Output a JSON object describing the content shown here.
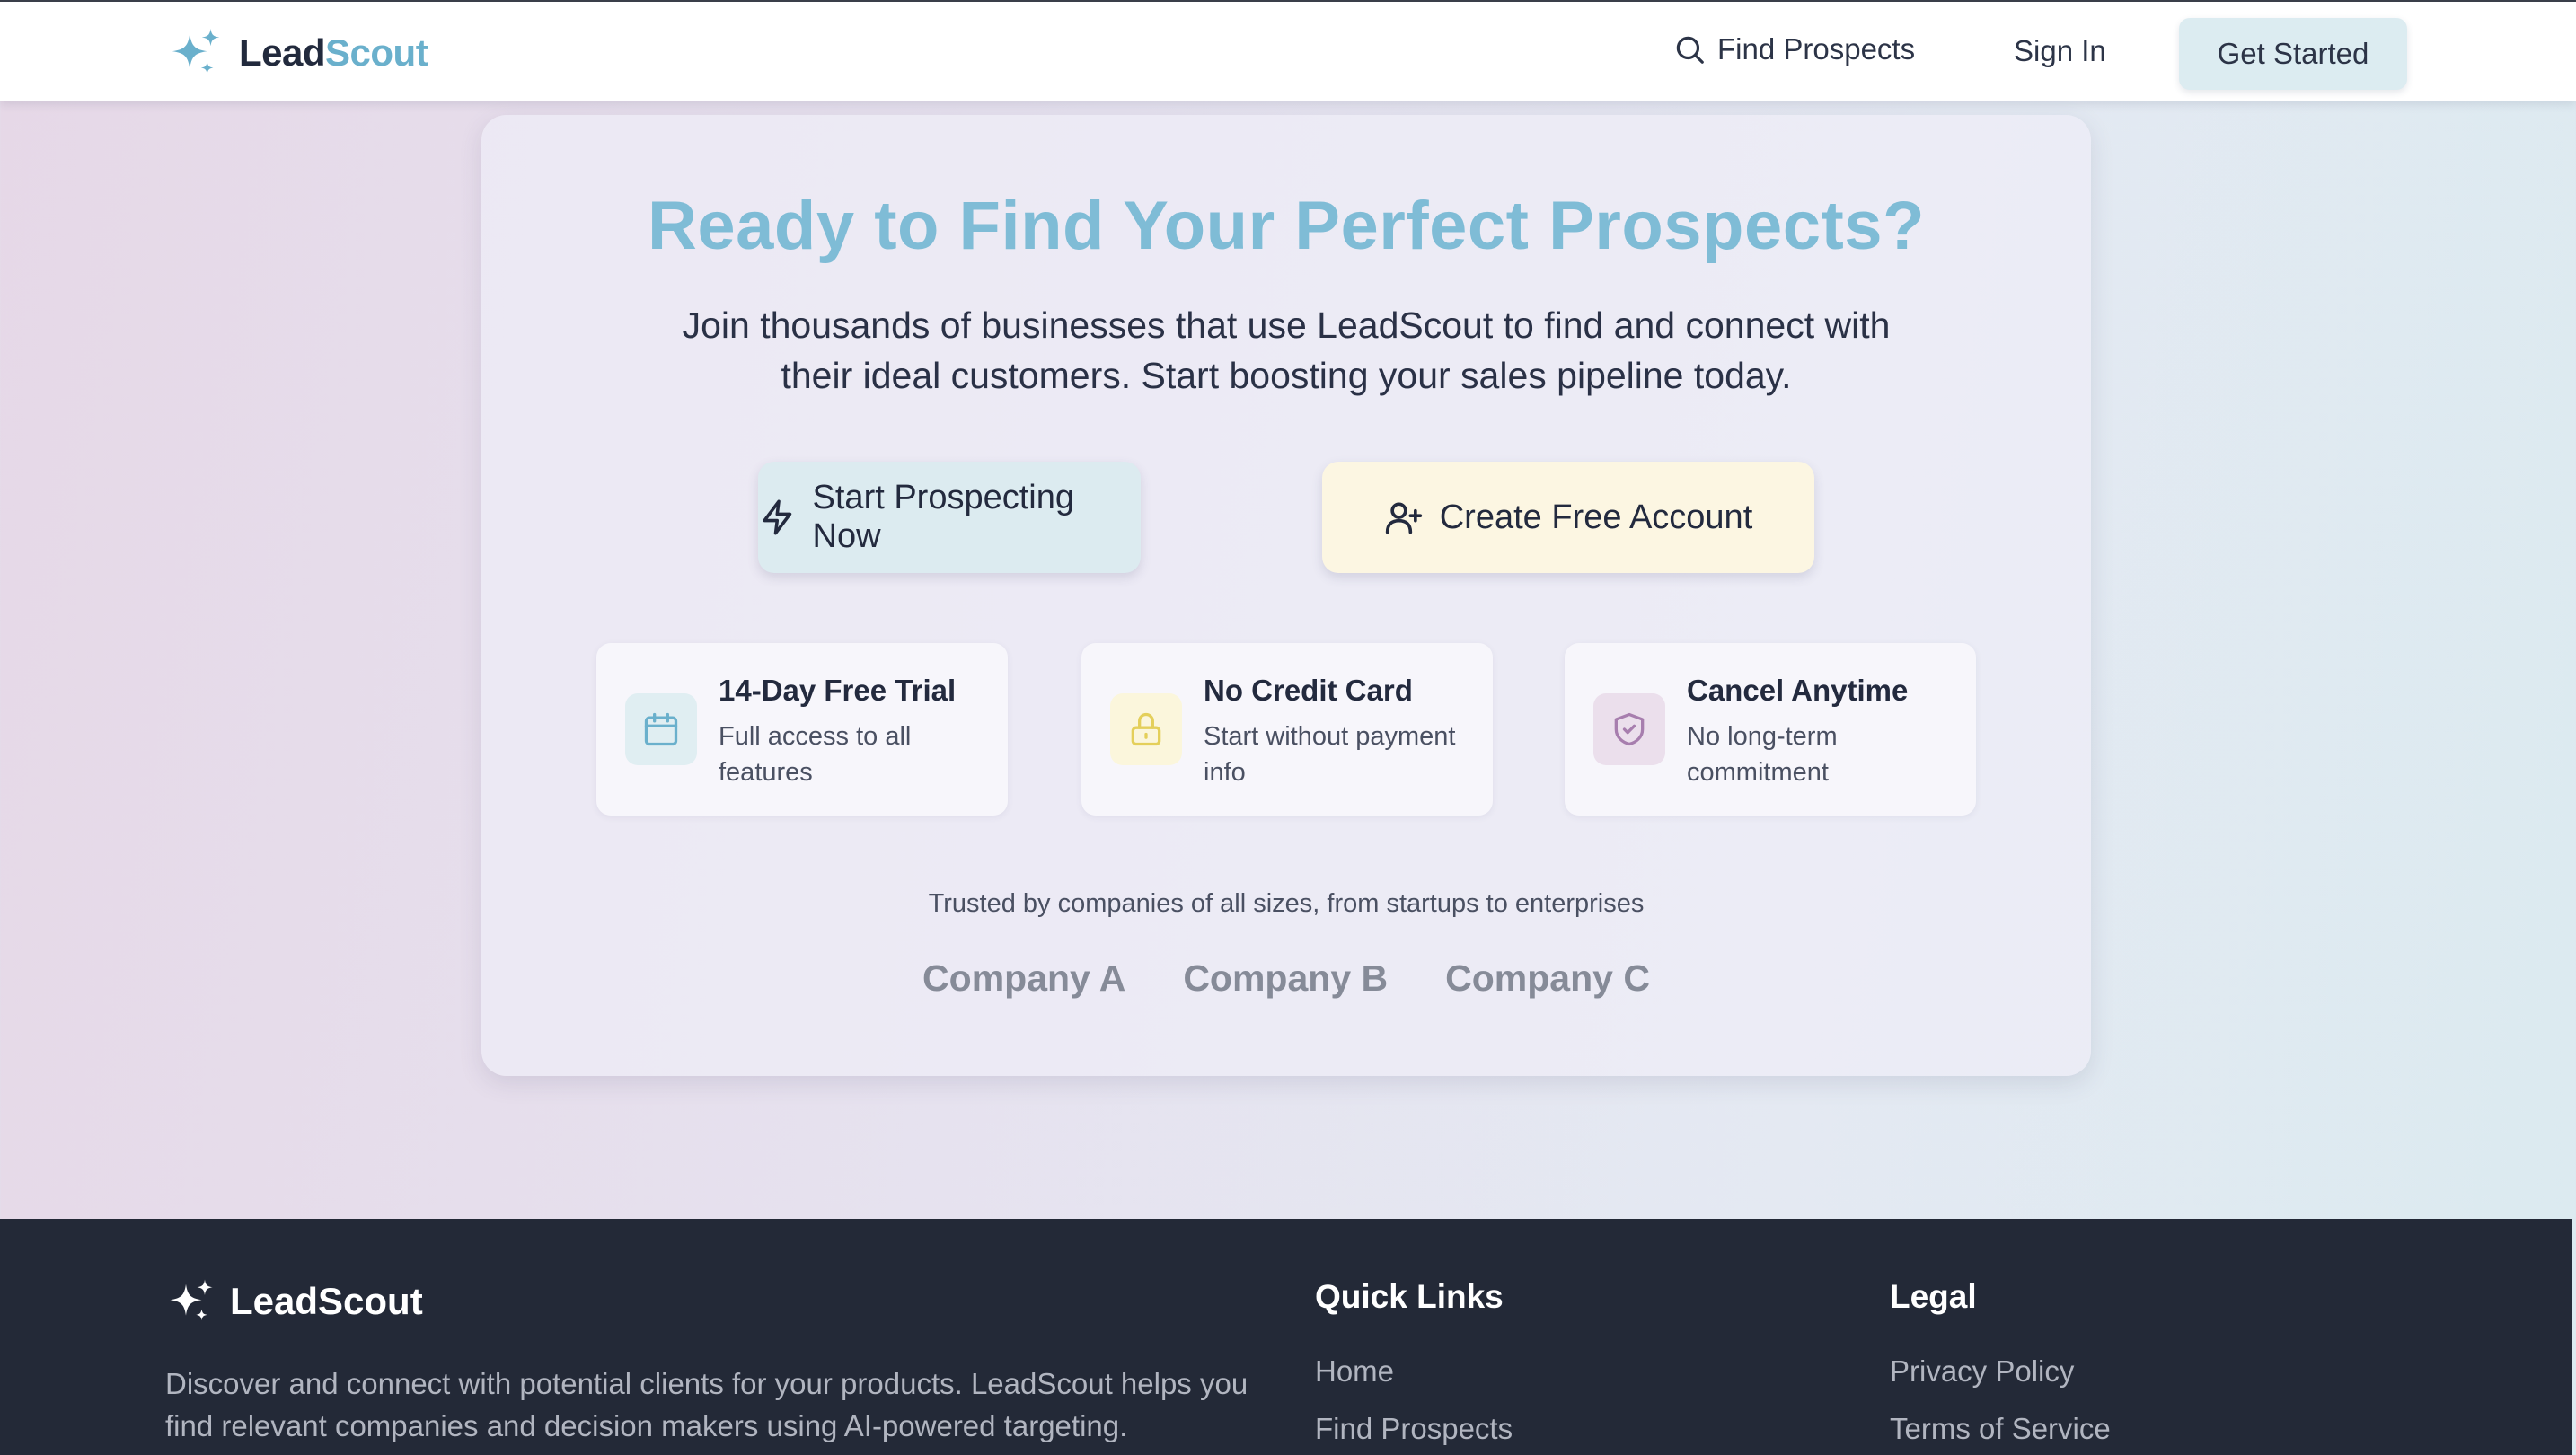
{
  "header": {
    "logo_part1": "Lead",
    "logo_part2": "Scout",
    "nav_find": "Find Prospects",
    "nav_signin": "Sign In",
    "nav_cta": "Get Started"
  },
  "cta": {
    "title": "Ready to Find Your Perfect Prospects?",
    "subtitle": "Join thousands of businesses that use LeadScout to find and connect with their ideal customers. Start boosting your sales pipeline today.",
    "primary_button": "Start Prospecting Now",
    "secondary_button": "Create Free Account",
    "features": [
      {
        "title": "14-Day Free Trial",
        "description": "Full access to all features",
        "icon": "calendar-icon"
      },
      {
        "title": "No Credit Card",
        "description": "Start without payment info",
        "icon": "lock-icon"
      },
      {
        "title": "Cancel Anytime",
        "description": "No long-term commitment",
        "icon": "shield-check-icon"
      }
    ],
    "trusted_text": "Trusted by companies of all sizes, from startups to enterprises",
    "companies": [
      "Company A",
      "Company B",
      "Company C"
    ]
  },
  "footer": {
    "brand": "LeadScout",
    "description": "Discover and connect with potential clients for your products. LeadScout helps you find relevant companies and decision makers using AI-powered targeting.",
    "quick_links_title": "Quick Links",
    "quick_links": [
      "Home",
      "Find Prospects"
    ],
    "legal_title": "Legal",
    "legal_links": [
      "Privacy Policy",
      "Terms of Service"
    ]
  },
  "colors": {
    "brand_blue": "#6ab0cc",
    "title_blue": "#7fbcd6",
    "dark_navy": "#232937",
    "primary_btn": "#dcebf0",
    "secondary_btn": "#fcf6e2"
  }
}
